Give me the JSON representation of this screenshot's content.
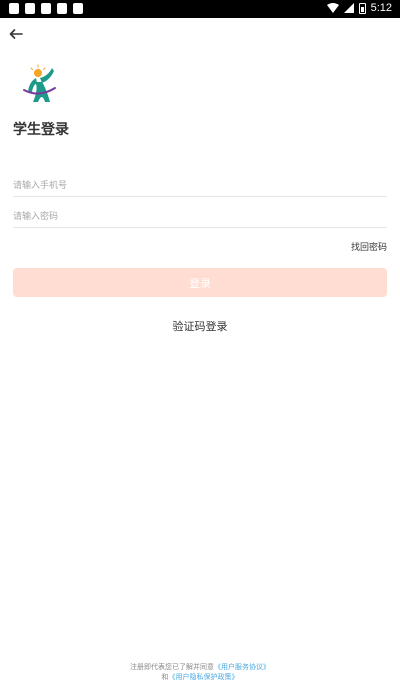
{
  "status_bar": {
    "time": "5:12",
    "notification_icons": [
      "notification-icon",
      "notification-icon",
      "notification-icon",
      "notification-icon",
      "notification-icon"
    ],
    "icons": [
      "wifi-icon",
      "signal-icon",
      "battery-icon"
    ]
  },
  "header": {
    "back_icon": "arrow-left-icon"
  },
  "login": {
    "title": "学生登录",
    "phone_placeholder": "请输入手机号",
    "password_placeholder": "请输入密码",
    "forgot_label": "找回密码",
    "submit_label": "登录",
    "sms_login_label": "验证码登录"
  },
  "agreement": {
    "prefix": "注册即代表您已了解并同意",
    "service_link": "《用户服务协议》",
    "and": "和",
    "privacy_link": "《用户隐私保护政策》"
  },
  "colors": {
    "button_bg": "#ffddd3",
    "link": "#4aa8e0",
    "logo_orange": "#f5a623",
    "logo_teal": "#1e9a8a",
    "logo_purple": "#7a3aa0"
  }
}
